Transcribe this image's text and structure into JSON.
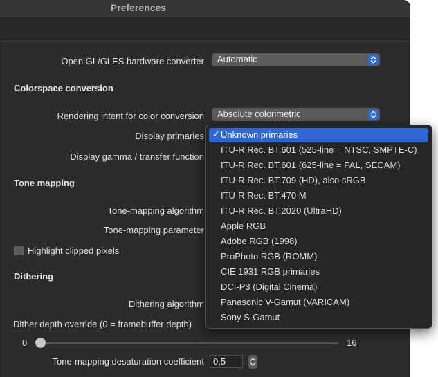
{
  "window": {
    "title": "Preferences"
  },
  "hw": {
    "label": "Open GL/GLES hardware converter",
    "value": "Automatic"
  },
  "colorspace": {
    "heading": "Colorspace conversion",
    "intent_label": "Rendering intent for color conversion",
    "intent_value": "Absolute colorimetric",
    "primaries_label": "Display primaries",
    "gamma_label": "Display gamma / transfer function"
  },
  "tone": {
    "heading": "Tone mapping",
    "algo_label": "Tone-mapping algorithm",
    "param_label": "Tone-mapping parameter",
    "highlight_label": "Highlight clipped pixels"
  },
  "dither": {
    "heading": "Dithering",
    "algo_label": "Dithering algorithm",
    "depth_label": "Dither depth override (0 = framebuffer depth)",
    "slider_min": "0",
    "slider_max": "16",
    "slider_value": 0
  },
  "desat": {
    "label": "Tone-mapping desaturation coefficient",
    "value": "0,5"
  },
  "menu": {
    "selected_index": 0,
    "checkmark": "✓",
    "items": [
      "Unknown primaries",
      "ITU-R Rec. BT.601 (525-line = NTSC, SMPTE-C)",
      "ITU-R Rec. BT.601 (625-line = PAL, SECAM)",
      "ITU-R Rec. BT.709 (HD), also sRGB",
      "ITU-R Rec. BT.470 M",
      "ITU-R Rec. BT.2020 (UltraHD)",
      "Apple RGB",
      "Adobe RGB (1998)",
      "ProPhoto RGB (ROMM)",
      "CIE 1931 RGB primaries",
      "DCI-P3 (Digital Cinema)",
      "Panasonic V-Gamut (VARICAM)",
      "Sony S-Gamut"
    ]
  },
  "colors": {
    "accent": "#2f66d2",
    "window_bg": "#282828",
    "panel_bg": "#2c2c2c"
  }
}
